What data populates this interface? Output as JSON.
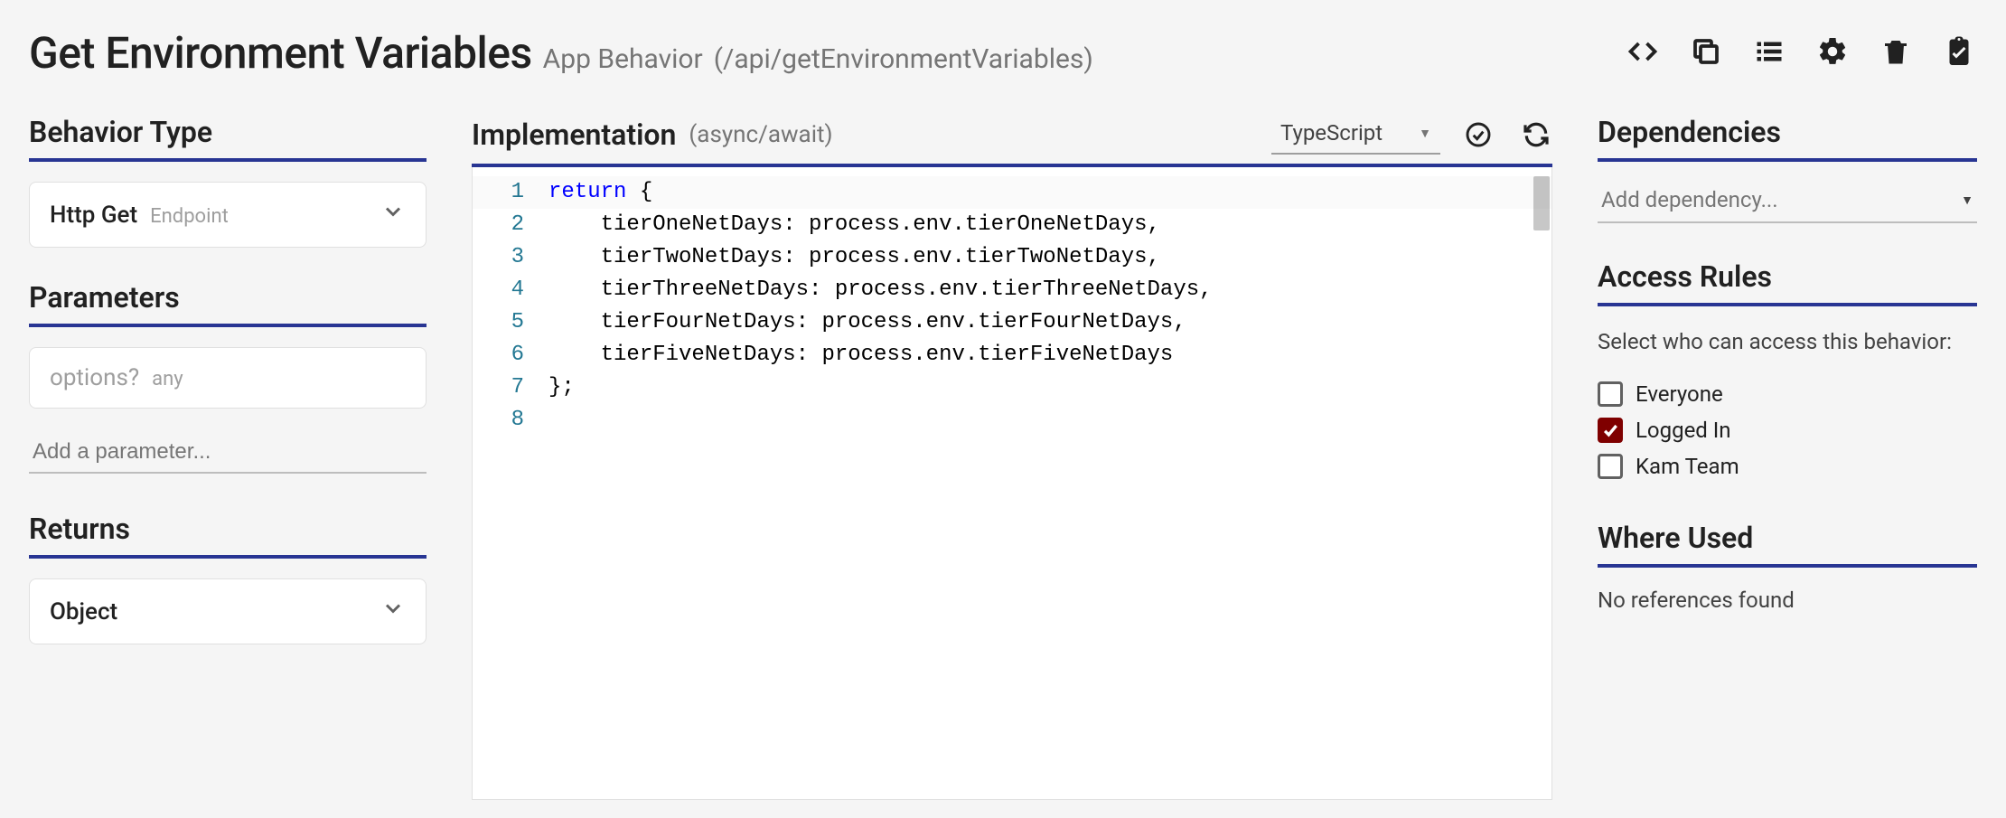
{
  "header": {
    "title": "Get Environment Variables",
    "subtitle": "App Behavior",
    "path": "(/api/getEnvironmentVariables)"
  },
  "toolbar_icons": {
    "code": "code-icon",
    "copy": "copy-icon",
    "list": "list-icon",
    "settings": "gear-icon",
    "delete": "trash-icon",
    "clipboard": "clipboard-icon"
  },
  "left": {
    "behavior_type_label": "Behavior Type",
    "behavior_type_value": "Http Get",
    "behavior_type_secondary": "Endpoint",
    "parameters_label": "Parameters",
    "param_name": "options?",
    "param_type": "any",
    "add_parameter_placeholder": "Add a parameter...",
    "returns_label": "Returns",
    "returns_value": "Object"
  },
  "center": {
    "implementation_label": "Implementation",
    "implementation_mode": "(async/await)",
    "language": "TypeScript",
    "code_lines": [
      "return {",
      "    tierOneNetDays: process.env.tierOneNetDays,",
      "    tierTwoNetDays: process.env.tierTwoNetDays,",
      "    tierThreeNetDays: process.env.tierThreeNetDays,",
      "    tierFourNetDays: process.env.tierFourNetDays,",
      "    tierFiveNetDays: process.env.tierFiveNetDays",
      "};",
      ""
    ]
  },
  "right": {
    "dependencies_label": "Dependencies",
    "add_dependency_placeholder": "Add dependency...",
    "access_rules_label": "Access Rules",
    "access_rules_help": "Select who can access this behavior:",
    "rules": [
      {
        "label": "Everyone",
        "checked": false
      },
      {
        "label": "Logged In",
        "checked": true
      },
      {
        "label": "Kam Team",
        "checked": false
      }
    ],
    "where_used_label": "Where Used",
    "no_references": "No references found"
  }
}
